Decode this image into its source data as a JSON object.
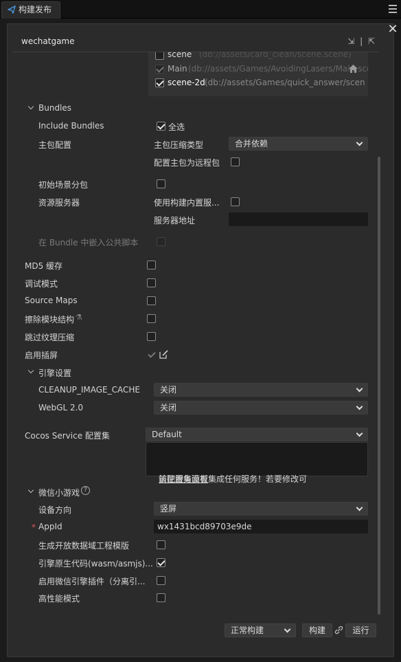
{
  "tab": {
    "title": "构建发布"
  },
  "header": {
    "platform": "wechatgame"
  },
  "scenes": [
    {
      "name": "scene",
      "path": "(db://assets/card_clean/scene.scene)",
      "checked": false
    },
    {
      "name": "Main",
      "path": "(db://assets/Games/AvoidingLasers/Main.sce",
      "checked": true
    },
    {
      "name": "scene-2d",
      "path": "(db://assets/Games/quick_answer/scen",
      "checked": true
    }
  ],
  "bundles": {
    "section": "Bundles",
    "include_label": "Include Bundles",
    "select_all": "全选",
    "main_pkg_label": "主包配置",
    "compress_type_label": "主包压缩类型",
    "compress_type_value": "合并依赖",
    "remote_main_label": "配置主包为远程包",
    "initial_scene_label": "初始场景分包",
    "resource_server_label": "资源服务器",
    "use_builtin_server_label": "使用构建内置服...",
    "server_addr_label": "服务器地址",
    "server_addr_value": "",
    "embed_script_label": "在 Bundle 中嵌入公共脚本"
  },
  "options": {
    "md5": "MD5 缓存",
    "debug": "调试模式",
    "sourcemaps": "Source Maps",
    "erase_module": "擦除模块结构",
    "skip_texture": "跳过纹理压缩",
    "splash": "启用插屏"
  },
  "engine": {
    "section": "引擎设置",
    "cleanup_label": "CLEANUP_IMAGE_CACHE",
    "cleanup_value": "关闭",
    "webgl_label": "WebGL 2.0",
    "webgl_value": "关闭"
  },
  "service": {
    "label": "Cocos Service 配置集",
    "value": "Default",
    "notice": "该配置集没有集成任何服务！若要修改可",
    "notice_link": "前往服务面板"
  },
  "wechat": {
    "section": "微信小游戏",
    "orientation_label": "设备方向",
    "orientation_value": "竖屏",
    "appid_required": "*",
    "appid_label": "AppId",
    "appid_value": "wx1431bcd89703e9de",
    "open_data_label": "生成开放数据域工程模版",
    "native_code_label": "引擎原生代码(wasm/asmjs)...",
    "plugin_label": "启用微信引擎插件（分离引...",
    "high_perf_label": "高性能模式"
  },
  "footer": {
    "build_mode": "正常构建",
    "build_label": "构建",
    "run_label": "运行"
  },
  "colors": {
    "accent": "#4a9eea",
    "required": "#e05555",
    "panel": "#2b2b2b"
  }
}
